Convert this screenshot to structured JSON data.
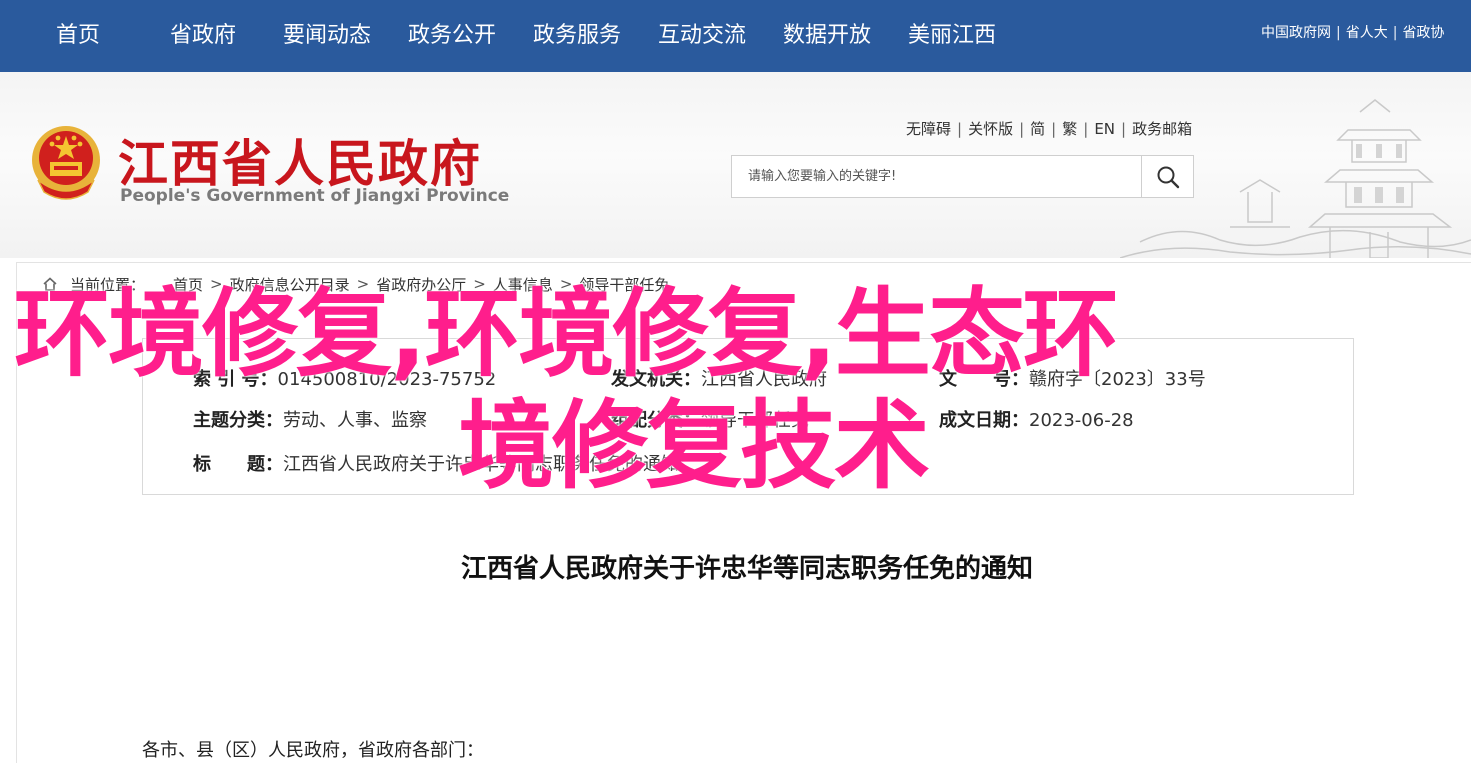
{
  "nav": {
    "items": [
      "首页",
      "省政府",
      "要闻动态",
      "政务公开",
      "政务服务",
      "互动交流",
      "数据开放",
      "美丽江西"
    ],
    "right_links": [
      "中国政府网",
      "省人大",
      "省政协"
    ]
  },
  "header": {
    "title": "江西省人民政府",
    "subtitle": "People's Government of Jiangxi Province",
    "util_links": [
      "无障碍",
      "关怀版",
      "简",
      "繁",
      "EN",
      "政务邮箱"
    ],
    "search_placeholder": "请输入您要输入的关键字!"
  },
  "breadcrumb": {
    "label": "当前位置：",
    "items": [
      "首页",
      "政府信息公开目录",
      "省政府办公厅",
      "人事信息",
      "领导干部任免"
    ]
  },
  "meta": {
    "index_label": "索 引 号：",
    "index_value": "014500810/2023-75752",
    "issuer_label": "发文机关：",
    "issuer_value": "江西省人民政府",
    "docno_label": "文　　号：",
    "docno_value": "赣府字〔2023〕33号",
    "topic_label": "主题分类：",
    "topic_value": "劳动、人事、监察",
    "genre_label": "组配分类：",
    "genre_value": "领导干部任免",
    "date_label": "成文日期：",
    "date_value": "2023-06-28",
    "title_label": "标　　题：",
    "title_value": "江西省人民政府关于许忠华等同志职务任免的通知"
  },
  "document": {
    "title": "江西省人民政府关于许忠华等同志职务任免的通知",
    "salutation": "各市、县（区）人民政府，省政府各部门："
  },
  "overlay": {
    "line1": "环境修复,环境修复,生态环",
    "line2": "境修复技术"
  },
  "colors": {
    "nav_bg": "#2a5a9d",
    "title_red": "#c8161d",
    "overlay_pink": "#ff1e8c"
  }
}
